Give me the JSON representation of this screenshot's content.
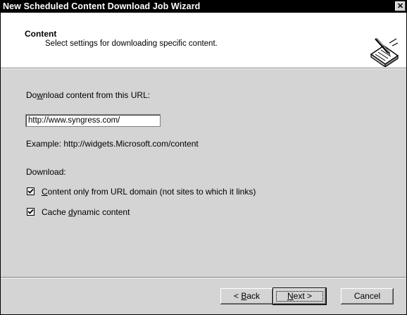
{
  "window": {
    "title": "New Scheduled Content Download Job Wizard",
    "close_glyph": "✕"
  },
  "header": {
    "title": "Content",
    "subtitle": "Select settings for downloading specific content.",
    "icon": "wizard-document-icon"
  },
  "form": {
    "url_label_pre": "Do",
    "url_label_accel": "w",
    "url_label_post": "nload content from this URL:",
    "url_value": "http://www.syngress.com/",
    "example": "Example: http://widgets.Microsoft.com/content",
    "download_label": "Download:",
    "options": [
      {
        "accel": "C",
        "label_rest": "ontent only from URL domain (not sites to which it links)",
        "checked": true
      },
      {
        "label_pre": "Cache ",
        "accel": "d",
        "label_rest": "ynamic content",
        "checked": true
      }
    ]
  },
  "buttons": {
    "back_prefix": "< ",
    "back_accel": "B",
    "back_rest": "ack",
    "next_accel": "N",
    "next_rest": "ext >",
    "cancel": "Cancel"
  }
}
